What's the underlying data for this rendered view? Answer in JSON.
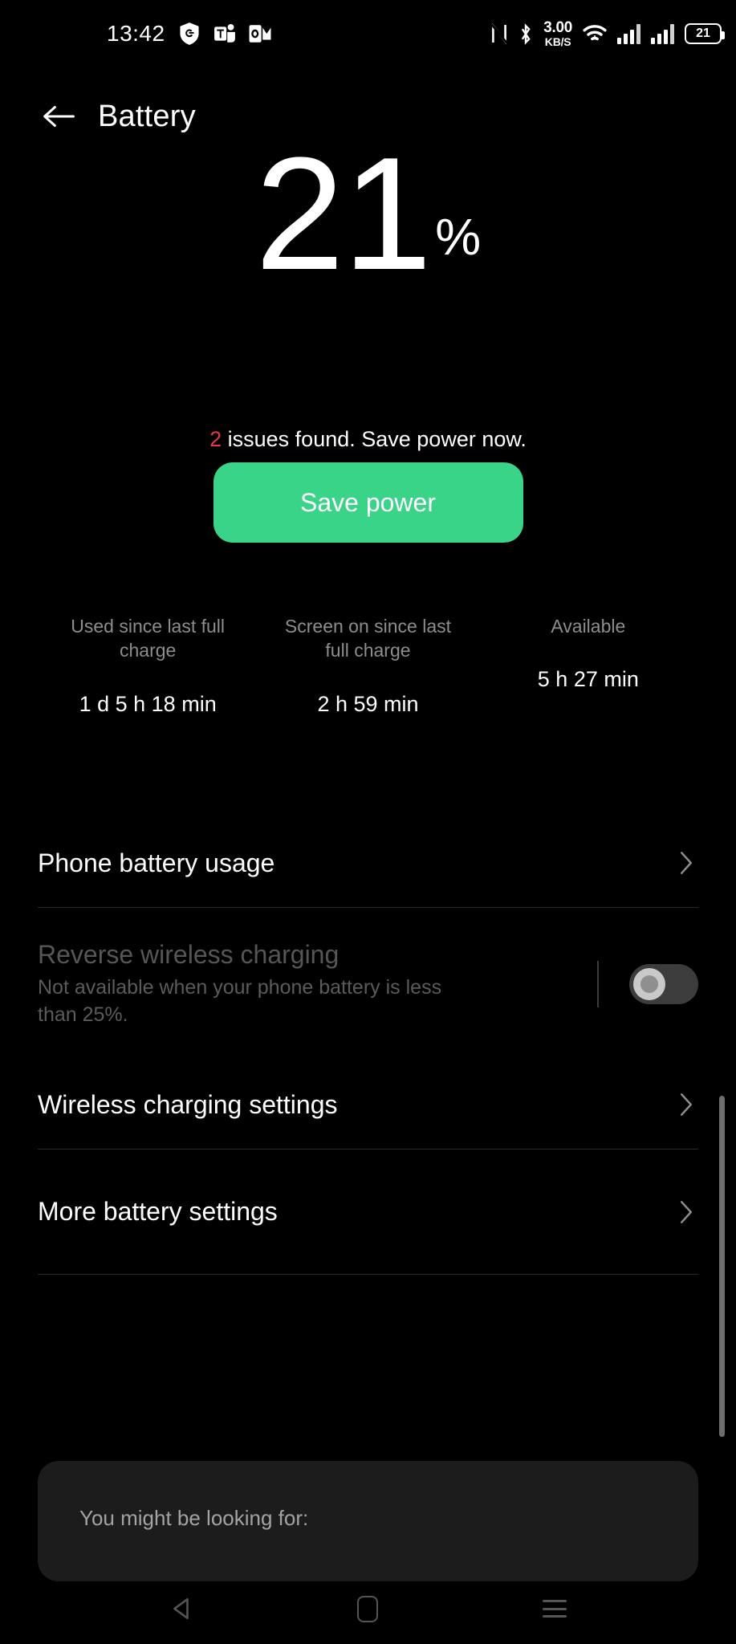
{
  "status_bar": {
    "time": "13:42",
    "left_icons": [
      "shield-icon",
      "teams-icon",
      "outlook-icon"
    ],
    "nfc_icon": "nfc-icon",
    "bluetooth_icon": "bluetooth-icon",
    "data_rate_value": "3.00",
    "data_rate_unit": "KB/S",
    "wifi_icon": "wifi-icon",
    "signal_icon": "signal-bars-icon",
    "battery_level": "21"
  },
  "header": {
    "back_icon": "back-arrow-icon",
    "title": "Battery"
  },
  "battery": {
    "percent": "21",
    "percent_symbol": "%",
    "issue_count": "2",
    "issue_text": " issues found. Save power now.",
    "save_button_label": "Save power",
    "save_button_color": "#3ad489"
  },
  "stats": [
    {
      "label": "Used since last full charge",
      "value": "1 d 5 h 18 min"
    },
    {
      "label": "Screen on since last full charge",
      "value": "2 h 59 min"
    },
    {
      "label": "Available",
      "value": "5 h 27 min"
    }
  ],
  "rows": {
    "phone_battery_usage": {
      "title": "Phone battery usage"
    },
    "reverse_wireless_charging": {
      "title": "Reverse wireless charging",
      "subtitle": "Not available when your phone battery is less than 25%.",
      "toggle_state": "off"
    },
    "wireless_charging_settings": {
      "title": "Wireless charging settings"
    },
    "more_battery_settings": {
      "title": "More battery settings"
    }
  },
  "suggestion_card": {
    "title": "You might be looking for:"
  },
  "navbar": {
    "back_label": "back-nav-icon",
    "home_label": "home-nav-icon",
    "recents_label": "recents-nav-icon"
  },
  "colors": {
    "accent_green": "#3ad489",
    "issue_red": "#e8374a",
    "background": "#000000",
    "muted_text": "#8d8d8d",
    "disabled_text": "#565656"
  }
}
